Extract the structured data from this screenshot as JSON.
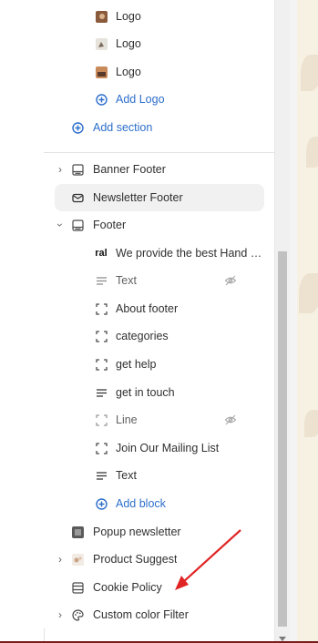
{
  "sidebar": {
    "logos": [
      {
        "label": "Logo",
        "icon": "logo-thumbnail-icon"
      },
      {
        "label": "Logo",
        "icon": "logo-thumbnail-icon"
      },
      {
        "label": "Logo",
        "icon": "logo-thumbnail-icon"
      }
    ],
    "add_logo_label": "Add Logo",
    "add_section_label": "Add section",
    "sections": {
      "banner_footer": "Banner Footer",
      "newsletter_footer": "Newsletter Footer",
      "footer": "Footer"
    },
    "footer_blocks": [
      {
        "label": "We provide the best Hand M...",
        "icon_text": "ral"
      },
      {
        "label": "Text",
        "hidden": true
      },
      {
        "label": "About footer"
      },
      {
        "label": "categories"
      },
      {
        "label": "get help"
      },
      {
        "label": "get in touch"
      },
      {
        "label": "Line",
        "hidden": true
      },
      {
        "label": "Join Our Mailing List"
      },
      {
        "label": "Text"
      }
    ],
    "add_block_label": "Add block",
    "after_sections": {
      "popup_newsletter": "Popup newsletter",
      "product_suggest": "Product Suggest",
      "cookie_policy": "Cookie Policy",
      "custom_color_filter": "Custom color Filter"
    }
  },
  "colors": {
    "accent_blue": "#2c6ecb",
    "annotation_red": "#e02424"
  }
}
